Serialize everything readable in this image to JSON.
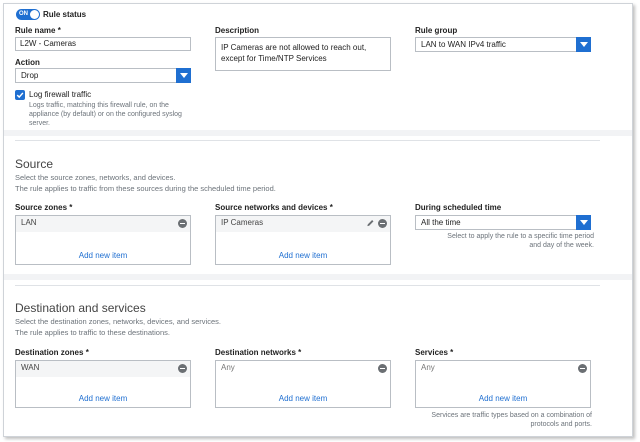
{
  "rule_status": {
    "toggle_text": "ON",
    "label": "Rule status"
  },
  "rule_name": {
    "label": "Rule name",
    "required": "*",
    "value": "L2W - Cameras"
  },
  "description": {
    "label": "Description",
    "value": "IP Cameras are not allowed to reach out, except for Time/NTP Services"
  },
  "rule_group": {
    "label": "Rule group",
    "value": "LAN to WAN IPv4 traffic"
  },
  "action": {
    "label": "Action",
    "value": "Drop"
  },
  "log": {
    "label": "Log firewall traffic",
    "hint": "Logs traffic, matching this firewall rule, on the appliance (by default) or on the configured syslog server."
  },
  "source": {
    "title": "Source",
    "desc1": "Select the source zones, networks, and devices.",
    "desc2": "The rule applies to traffic from these sources during the scheduled time period.",
    "zones": {
      "label": "Source zones",
      "item": "LAN",
      "add": "Add new item"
    },
    "networks": {
      "label": "Source networks and devices",
      "item": "IP Cameras",
      "add": "Add new item"
    },
    "schedule": {
      "label": "During scheduled time",
      "value": "All the time",
      "hint": "Select to apply the rule to a specific time period and day of the week."
    }
  },
  "destination": {
    "title": "Destination and services",
    "desc1": "Select the destination zones, networks, devices, and services.",
    "desc2": "The rule applies to traffic to these destinations.",
    "zones": {
      "label": "Destination zones",
      "item": "WAN",
      "add": "Add new item"
    },
    "networks": {
      "label": "Destination networks",
      "item": "Any",
      "add": "Add new item"
    },
    "services": {
      "label": "Services",
      "item": "Any",
      "add": "Add new item",
      "hint": "Services are traffic types based on a combination of protocols and ports."
    }
  },
  "colors": {
    "accent": "#1f6fd1",
    "remove_icon": "#6b6f73",
    "muted_text": "#6c737a"
  }
}
